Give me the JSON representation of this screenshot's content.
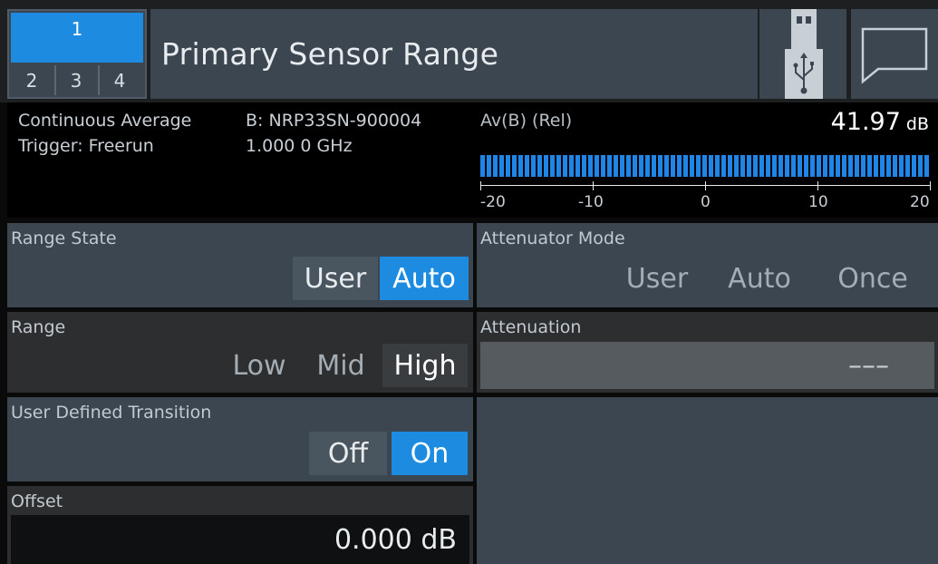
{
  "header": {
    "windows": {
      "main": "1",
      "others": [
        "2",
        "3",
        "4"
      ]
    },
    "title": "Primary Sensor Range",
    "usb_icon": "usb-icon",
    "message_icon": "speech-bubble-icon"
  },
  "measurement": {
    "mode": "Continuous Average",
    "trigger": "Trigger: Freerun",
    "sensor": "B: NRP33SN-900004",
    "frequency": "1.000 0 GHz",
    "reading_label": "Av(B) (Rel)",
    "reading_value": "41.97",
    "reading_unit": "dB",
    "bar_fill": 1.0,
    "scale": [
      "-20",
      "-10",
      "0",
      "10",
      "20"
    ]
  },
  "range_state": {
    "label": "Range State",
    "options": [
      "User",
      "Auto"
    ],
    "selected": "Auto"
  },
  "attenuator_mode": {
    "label": "Attenuator Mode",
    "options": [
      "User",
      "Auto",
      "Once"
    ]
  },
  "range": {
    "label": "Range",
    "options": [
      "Low",
      "Mid",
      "High"
    ],
    "selected": "High"
  },
  "attenuation": {
    "label": "Attenuation",
    "value": "–––"
  },
  "user_defined_transition": {
    "label": "User Defined Transition",
    "options": [
      "Off",
      "On"
    ],
    "selected": "On"
  },
  "offset": {
    "label": "Offset",
    "value": "0.000 dB"
  },
  "colors": {
    "accent": "#1d8ce0",
    "panel": "#3b4650",
    "panel_dark": "#2c2e30"
  }
}
